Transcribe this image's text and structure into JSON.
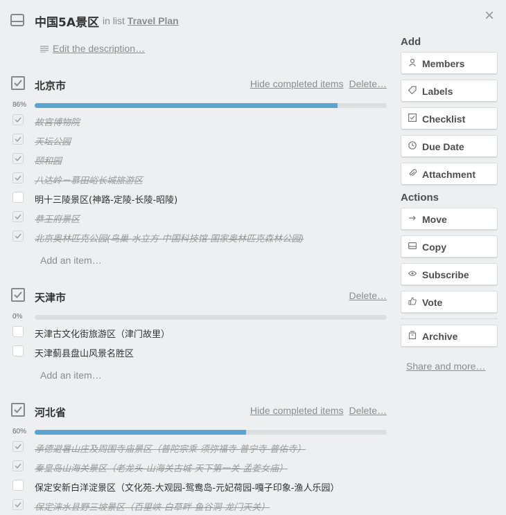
{
  "card": {
    "title": "中国5A景区",
    "in_list_prefix": "in list",
    "list_name": "Travel Plan",
    "close_glyph": "×",
    "edit_description": "Edit the description…"
  },
  "checklists": [
    {
      "title": "北京市",
      "hide_label": "Hide completed items",
      "delete_label": "Delete…",
      "percent_label": "86%",
      "percent": 86,
      "items": [
        {
          "text": "故宫博物院",
          "done": true
        },
        {
          "text": "天坛公园",
          "done": true
        },
        {
          "text": "颐和园",
          "done": true
        },
        {
          "text": "八达岭－慕田峪长城旅游区",
          "done": true
        },
        {
          "text": "明十三陵景区(神路-定陵-长陵-昭陵)",
          "done": false
        },
        {
          "text": "恭王府景区",
          "done": true
        },
        {
          "text": "北京奥林匹克公园(鸟巢-水立方-中国科技馆-国家奥林匹克森林公园)",
          "done": true
        }
      ],
      "add_item": "Add an item…"
    },
    {
      "title": "天津市",
      "hide_label": "",
      "delete_label": "Delete…",
      "percent_label": "0%",
      "percent": 0,
      "items": [
        {
          "text": "天津古文化街旅游区（津门故里）",
          "done": false
        },
        {
          "text": "天津蓟县盘山风景名胜区",
          "done": false
        }
      ],
      "add_item": "Add an item…"
    },
    {
      "title": "河北省",
      "hide_label": "Hide completed items",
      "delete_label": "Delete…",
      "percent_label": "60%",
      "percent": 60,
      "items": [
        {
          "text": "承德避暑山庄及周围寺庙景区（普陀宗乘-须弥福寺-普宁寺-普佑寺）",
          "done": true
        },
        {
          "text": "秦皇岛山海关景区（老龙头-山海关古城-天下第一关-孟姜女庙）",
          "done": true
        },
        {
          "text": "保定安新白洋淀景区（文化苑-大观园-鸳鸯岛-元妃荷园-嘎子印象-渔人乐园）",
          "done": false
        },
        {
          "text": "保定涞水县野三坡景区（百里峡-白草畔-鱼谷洞-龙门天关）",
          "done": true
        }
      ],
      "add_item": ""
    }
  ],
  "sidebar": {
    "add_heading": "Add",
    "add_buttons": [
      {
        "label": "Members",
        "icon": "person-icon"
      },
      {
        "label": "Labels",
        "icon": "tag-icon"
      },
      {
        "label": "Checklist",
        "icon": "checklist-icon"
      },
      {
        "label": "Due Date",
        "icon": "clock-icon"
      },
      {
        "label": "Attachment",
        "icon": "paperclip-icon"
      }
    ],
    "actions_heading": "Actions",
    "action_buttons": [
      {
        "label": "Move",
        "icon": "arrow-right-icon"
      },
      {
        "label": "Copy",
        "icon": "card-icon"
      },
      {
        "label": "Subscribe",
        "icon": "eye-icon"
      },
      {
        "label": "Vote",
        "icon": "thumbs-up-icon"
      }
    ],
    "archive_button": {
      "label": "Archive",
      "icon": "archive-icon"
    },
    "share_link": "Share and more…"
  },
  "colors": {
    "progress_fill": "#5ba4cf",
    "progress_track": "#dcdfe0",
    "background": "#edeff0"
  }
}
